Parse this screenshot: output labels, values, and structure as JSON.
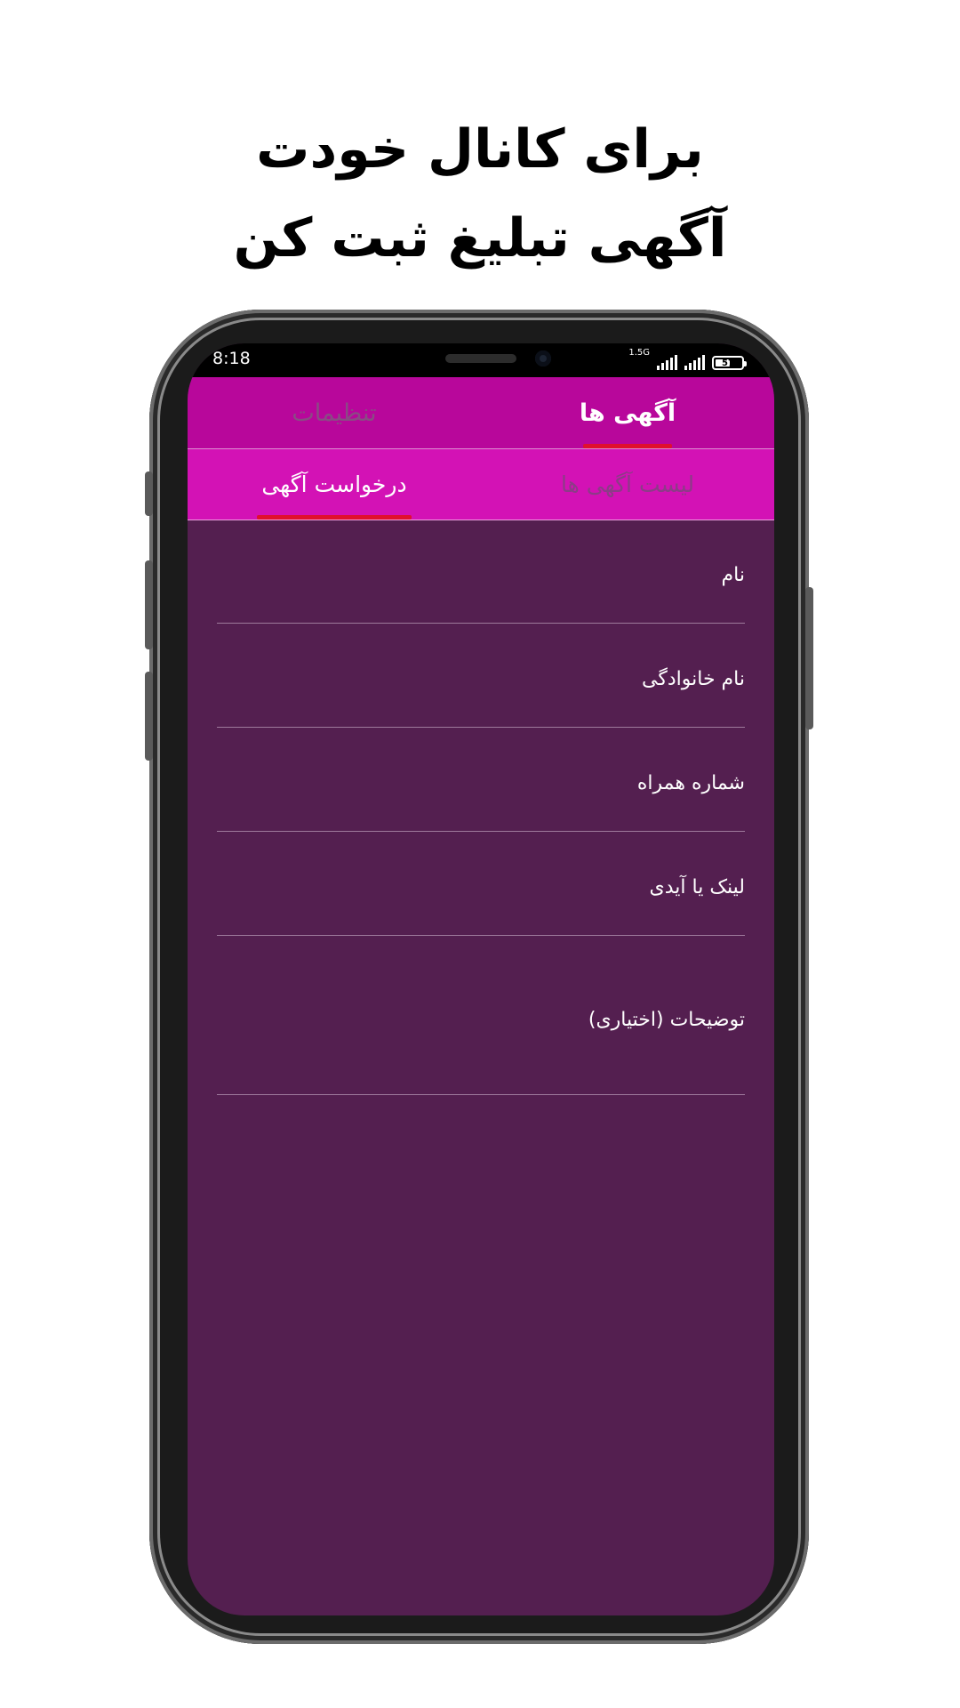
{
  "headline": {
    "line1": "برای کانال خودت",
    "line2": "آگهی تبلیغ ثبت کن"
  },
  "status_bar": {
    "time": "8:18",
    "network": "1.5G",
    "battery": "57",
    "battery_level": 0.57
  },
  "main_tabs": [
    {
      "label": "آگهی ها",
      "active": true
    },
    {
      "label": "تنظیمات",
      "active": false
    }
  ],
  "sub_tabs": [
    {
      "label": "لیست آگهی ها",
      "active": false
    },
    {
      "label": "درخواست آگهی",
      "active": true
    }
  ],
  "form": {
    "fields": [
      {
        "label": "نام"
      },
      {
        "label": "نام خانوادگی"
      },
      {
        "label": "شماره همراه"
      },
      {
        "label": "لینک یا آیدی"
      },
      {
        "label": "توضیحات (اختیاری)"
      }
    ]
  },
  "colors": {
    "topbar": "#b8079b",
    "subbar": "#d312b5",
    "background": "#541f50",
    "indicator": "#e0102e"
  }
}
